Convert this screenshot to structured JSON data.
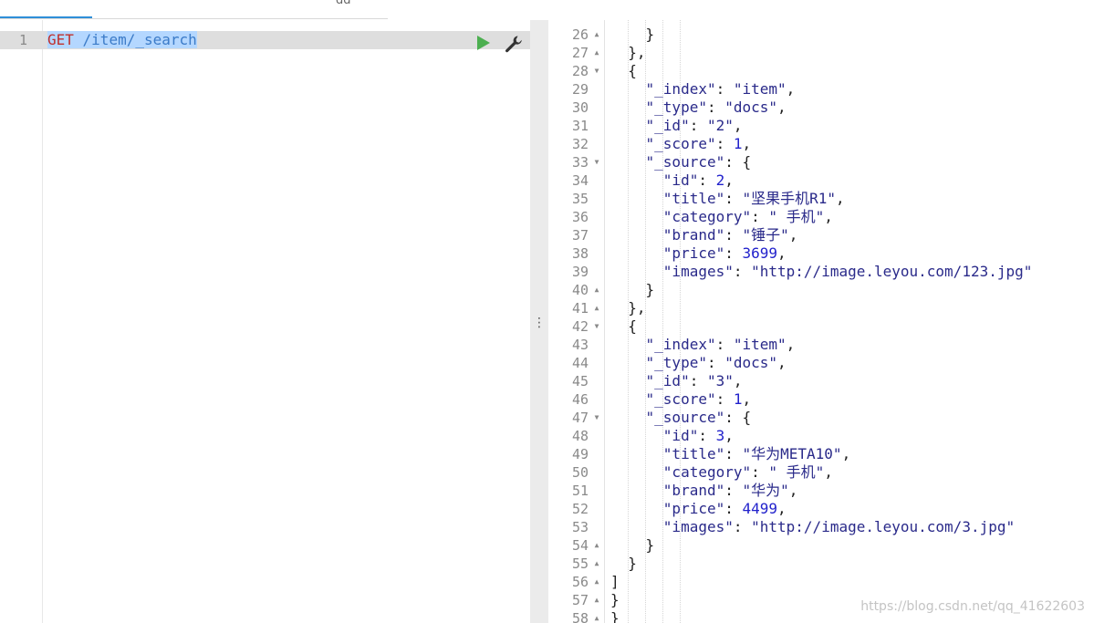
{
  "tabs": {
    "partial_tab_text": "gg"
  },
  "request_editor": {
    "line_number": "1",
    "method": "GET",
    "url": " /item/_search",
    "run_label": "Run request",
    "settings_label": "Settings"
  },
  "splitter": {
    "handle": "⋮"
  },
  "response": {
    "lines": [
      {
        "num": "26",
        "fold": "▲",
        "text": "    }"
      },
      {
        "num": "27",
        "fold": "▲",
        "text": "  },"
      },
      {
        "num": "28",
        "fold": "▼",
        "text": "  {"
      },
      {
        "num": "29",
        "fold": "",
        "text": "    \"_index\": \"item\","
      },
      {
        "num": "30",
        "fold": "",
        "text": "    \"_type\": \"docs\","
      },
      {
        "num": "31",
        "fold": "",
        "text": "    \"_id\": \"2\","
      },
      {
        "num": "32",
        "fold": "",
        "text": "    \"_score\": 1,"
      },
      {
        "num": "33",
        "fold": "▼",
        "text": "    \"_source\": {"
      },
      {
        "num": "34",
        "fold": "",
        "text": "      \"id\": 2,"
      },
      {
        "num": "35",
        "fold": "",
        "text": "      \"title\": \"坚果手机R1\","
      },
      {
        "num": "36",
        "fold": "",
        "text": "      \"category\": \" 手机\","
      },
      {
        "num": "37",
        "fold": "",
        "text": "      \"brand\": \"锤子\","
      },
      {
        "num": "38",
        "fold": "",
        "text": "      \"price\": 3699,"
      },
      {
        "num": "39",
        "fold": "",
        "text": "      \"images\": \"http://image.leyou.com/123.jpg\""
      },
      {
        "num": "40",
        "fold": "▲",
        "text": "    }"
      },
      {
        "num": "41",
        "fold": "▲",
        "text": "  },"
      },
      {
        "num": "42",
        "fold": "▼",
        "text": "  {"
      },
      {
        "num": "43",
        "fold": "",
        "text": "    \"_index\": \"item\","
      },
      {
        "num": "44",
        "fold": "",
        "text": "    \"_type\": \"docs\","
      },
      {
        "num": "45",
        "fold": "",
        "text": "    \"_id\": \"3\","
      },
      {
        "num": "46",
        "fold": "",
        "text": "    \"_score\": 1,"
      },
      {
        "num": "47",
        "fold": "▼",
        "text": "    \"_source\": {"
      },
      {
        "num": "48",
        "fold": "",
        "text": "      \"id\": 3,"
      },
      {
        "num": "49",
        "fold": "",
        "text": "      \"title\": \"华为META10\","
      },
      {
        "num": "50",
        "fold": "",
        "text": "      \"category\": \" 手机\","
      },
      {
        "num": "51",
        "fold": "",
        "text": "      \"brand\": \"华为\","
      },
      {
        "num": "52",
        "fold": "",
        "text": "      \"price\": 4499,"
      },
      {
        "num": "53",
        "fold": "",
        "text": "      \"images\": \"http://image.leyou.com/3.jpg\""
      },
      {
        "num": "54",
        "fold": "▲",
        "text": "    }"
      },
      {
        "num": "55",
        "fold": "▲",
        "text": "  }"
      },
      {
        "num": "56",
        "fold": "▲",
        "text": "]"
      },
      {
        "num": "57",
        "fold": "▲",
        "text": "}"
      },
      {
        "num": "58",
        "fold": "▲",
        "text": "}"
      }
    ]
  },
  "watermark": "https://blog.csdn.net/qq_41622603",
  "colors": {
    "accent_tab": "#2f8fd8",
    "run_green": "#4caf50",
    "method_red": "#c0302b",
    "url_blue": "#3b7bc8",
    "selection": "#b4d7ff",
    "number_blue": "#2222cc",
    "string_navy": "#2a2a8a"
  }
}
